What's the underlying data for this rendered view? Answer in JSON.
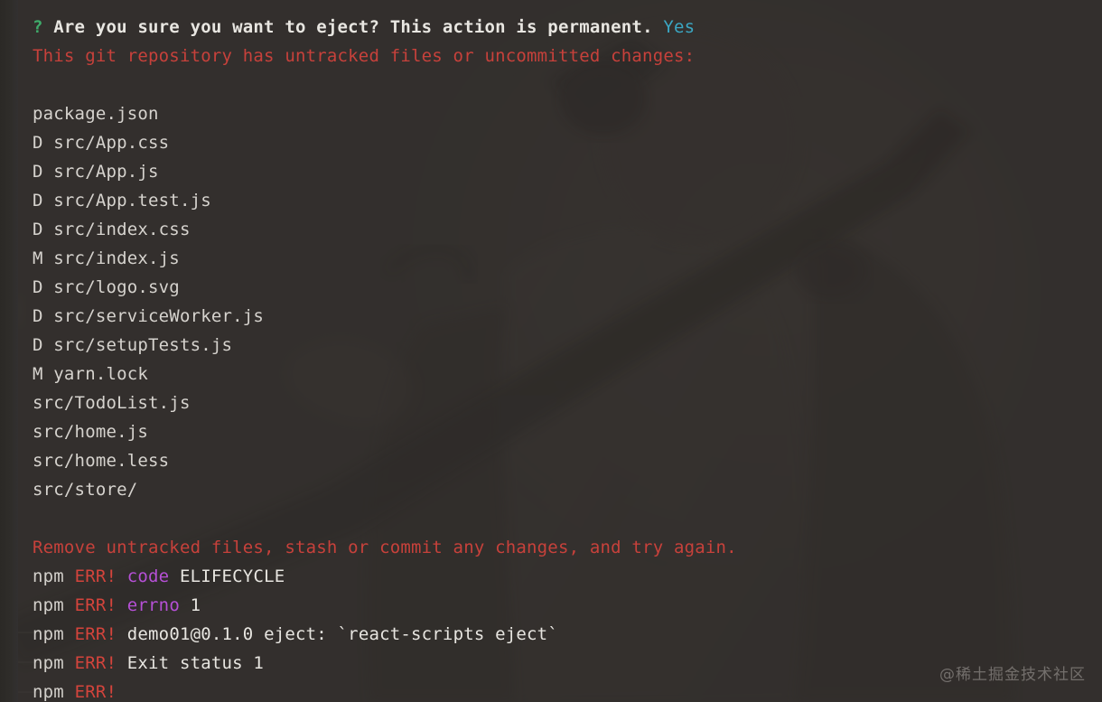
{
  "terminal": {
    "background_color": "#33302d",
    "default_text_color": "#d6d3ce",
    "font_size_px": 19,
    "line_height_px": 32,
    "colors": {
      "green": "#3fab6a",
      "cyan": "#3ba7c4",
      "red": "#c7413b",
      "magenta": "#b650d6",
      "white": "#e8e6e1"
    },
    "prompt": {
      "marker": "?",
      "question": "Are you sure you want to eject? This action is permanent.",
      "answer": "Yes"
    },
    "git_warning": "This git repository has untracked files or uncommitted changes:",
    "changed_files": [
      {
        "status": "",
        "path": "package.json"
      },
      {
        "status": "D",
        "path": "src/App.css"
      },
      {
        "status": "D",
        "path": "src/App.js"
      },
      {
        "status": "D",
        "path": "src/App.test.js"
      },
      {
        "status": "D",
        "path": "src/index.css"
      },
      {
        "status": "M",
        "path": "src/index.js"
      },
      {
        "status": "D",
        "path": "src/logo.svg"
      },
      {
        "status": "D",
        "path": "src/serviceWorker.js"
      },
      {
        "status": "D",
        "path": "src/setupTests.js"
      },
      {
        "status": "M",
        "path": "yarn.lock"
      },
      {
        "status": "",
        "path": "src/TodoList.js"
      },
      {
        "status": "",
        "path": "src/home.js"
      },
      {
        "status": "",
        "path": "src/home.less"
      },
      {
        "status": "",
        "path": "src/store/"
      }
    ],
    "advice": "Remove untracked files, stash or commit any changes, and try again.",
    "npm_errors": [
      {
        "prefix": "npm",
        "tag": "ERR!",
        "key": "code",
        "value": "ELIFECYCLE"
      },
      {
        "prefix": "npm",
        "tag": "ERR!",
        "key": "errno",
        "value": "1"
      },
      {
        "prefix": "npm",
        "tag": "ERR!",
        "key": "",
        "value": "demo01@0.1.0 eject: `react-scripts eject`"
      },
      {
        "prefix": "npm",
        "tag": "ERR!",
        "key": "",
        "value": "Exit status 1"
      },
      {
        "prefix": "npm",
        "tag": "ERR!",
        "key": "",
        "value": ""
      }
    ]
  },
  "watermark": {
    "text": "@稀土掘金技术社区"
  }
}
